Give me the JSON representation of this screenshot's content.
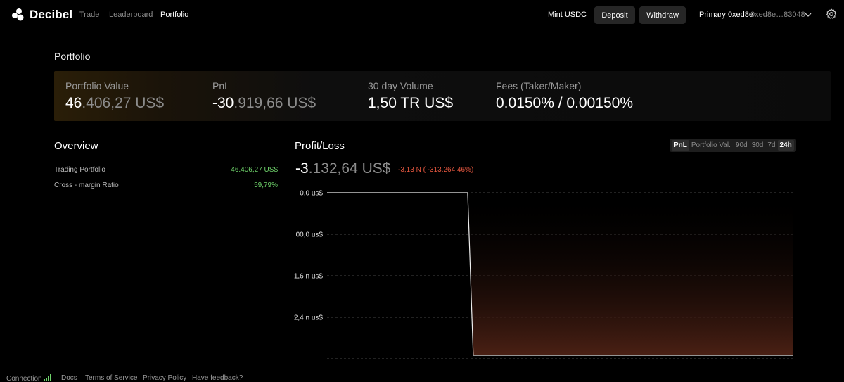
{
  "nav": {
    "brand": "Decibel",
    "links": [
      "Trade",
      "Leaderboard",
      "Portfolio"
    ],
    "mint": "Mint USDC",
    "deposit": "Deposit",
    "withdraw": "Withdraw",
    "account_name": "Primary 0xed8e",
    "account_address": "0xed8e…83048"
  },
  "page": {
    "title": "Portfolio"
  },
  "stats": {
    "portfolio_value": {
      "label": "Portfolio Value",
      "value_bright": "46",
      "value_dim": ".406,27 US$"
    },
    "pnl": {
      "label": "PnL",
      "value_bright": "-30",
      "value_dim": ".919,66 US$"
    },
    "volume": {
      "label": "30 day Volume",
      "value": "1,50 TR US$"
    },
    "fees": {
      "label": "Fees (Taker/Maker)",
      "value": "0.0150% / 0.00150%"
    }
  },
  "overview": {
    "title": "Overview",
    "rows": [
      {
        "label": "Trading Portfolio",
        "value": "46.406,27 US$"
      },
      {
        "label": "Cross - margin Ratio",
        "value": "59,79%"
      }
    ]
  },
  "profit_loss": {
    "title": "Profit/Loss",
    "value_bright": "-3",
    "value_dim": ".132,64 US$",
    "change": "-3,13 N ( -313.264,46%)",
    "metric_tabs": [
      "PnL",
      "Portfolio Val."
    ],
    "active_metric": "PnL",
    "range_tabs": [
      "90d",
      "30d",
      "7d",
      "24h"
    ],
    "active_range": "24h"
  },
  "colors": {
    "positive": "#6fd36b",
    "negative": "#e6573f",
    "area_fill": "#4a2014"
  },
  "chart_data": {
    "type": "area",
    "x": [
      0,
      0.302,
      0.314,
      1
    ],
    "y": [
      0,
      0,
      -3.132,
      -3.132
    ],
    "y_tick_labels": [
      "0,0 us$",
      "00,0 us$",
      "1,6 n us$",
      "2,4 n us$"
    ],
    "xlabel": "",
    "ylabel": "",
    "grid": true
  },
  "footer": {
    "connection": "Connection",
    "links": [
      "Docs",
      "Terms of Service",
      "Privacy Policy",
      "Have feedback?"
    ]
  }
}
